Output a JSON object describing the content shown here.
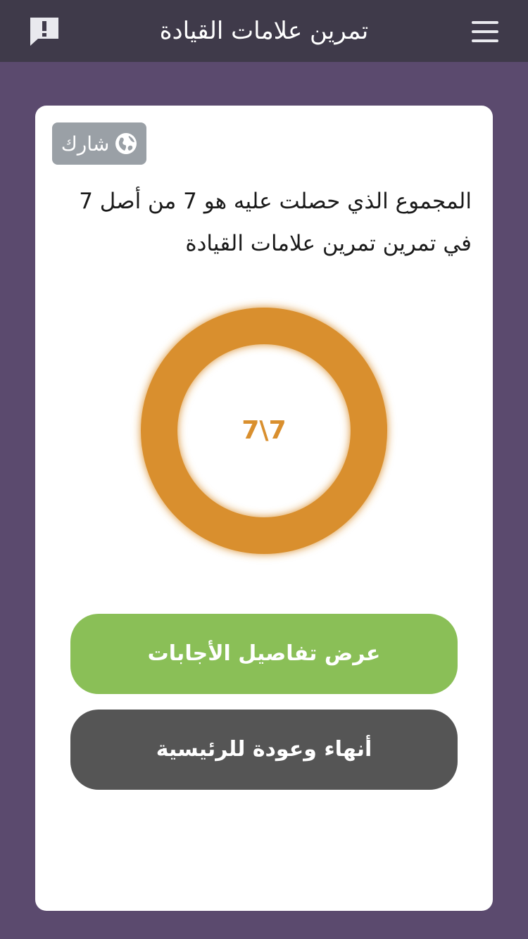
{
  "header": {
    "title": "تمرين علامات القيادة",
    "menu_icon": "hamburger-menu-icon",
    "feedback_icon": "feedback-exclamation-icon"
  },
  "share": {
    "label": "شارك",
    "icon": "globe-icon"
  },
  "result": {
    "line1": "المجموع الذي حصلت عليه هو 7 من أصل 7",
    "line2": "في تمرين تمرين علامات القيادة"
  },
  "score": {
    "display": "7\\7",
    "correct": 7,
    "total": 7,
    "progress_fraction": 1.0
  },
  "buttons": {
    "details_label": "عرض تفاصيل الأجابات",
    "home_label": "أنهاء وعودة  للرئيسية"
  },
  "colors": {
    "header_bg": "#3f3a4a",
    "page_bg": "#5b4a6e",
    "ring": "#d98f2e",
    "details_button": "#8abf57",
    "home_button": "#555555",
    "share_button": "#9aa0a6"
  }
}
